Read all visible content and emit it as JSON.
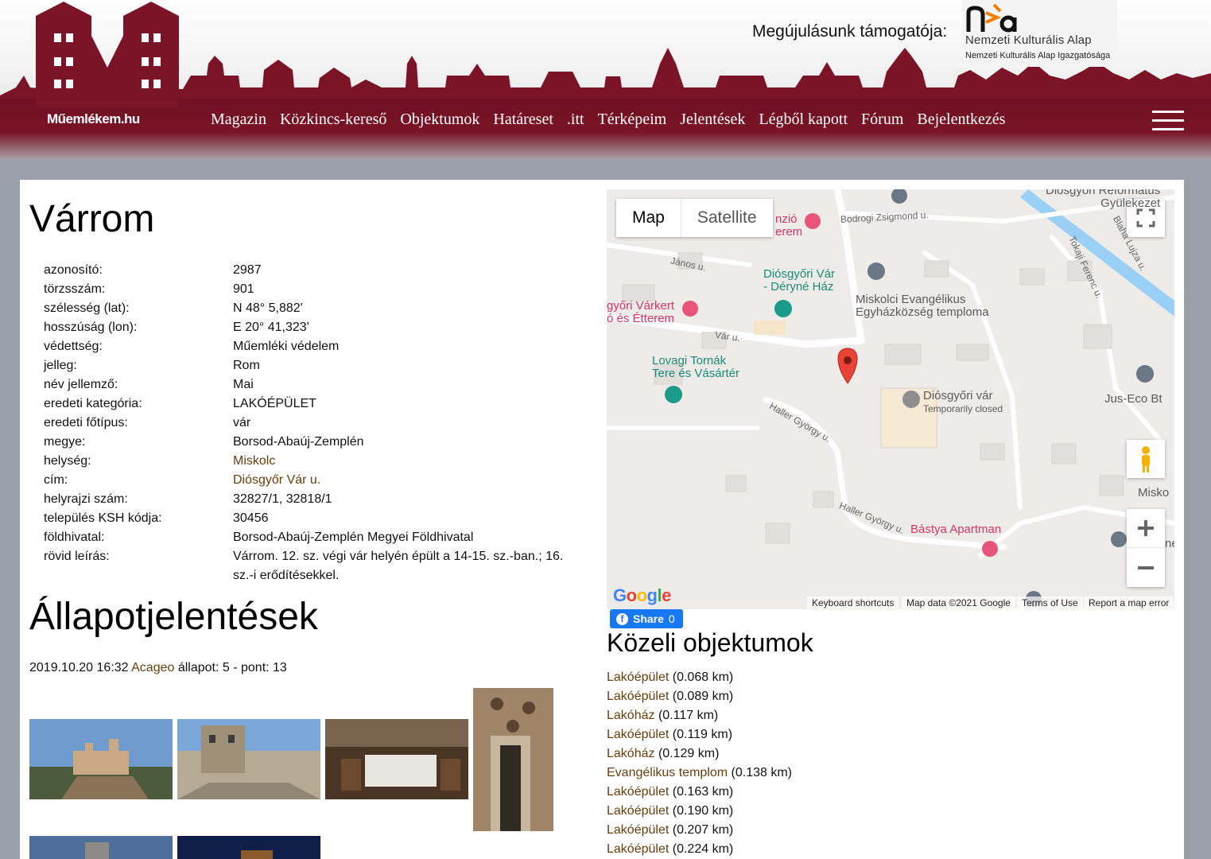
{
  "header": {
    "site_name": "Műemlékem.hu",
    "sponsor_label": "Megújulásunk támogatója:",
    "sponsor_name": "Nemzeti Kulturális Alap",
    "sponsor_sub": "Nemzeti Kulturális Alap Igazgatósága",
    "nav": [
      "Magazin",
      "Közkincs-kereső",
      "Objektumok",
      "Határeset",
      ".itt",
      "Térképeim",
      "Jelentések",
      "Légből kapott",
      "Fórum",
      "Bejelentkezés"
    ],
    "menu_icon": "hamburger-icon",
    "brand_color": "#7a1426"
  },
  "page": {
    "title": "Várrom",
    "details": [
      {
        "label": "azonosító:",
        "value": "2987"
      },
      {
        "label": "törzsszám:",
        "value": "901"
      },
      {
        "label": "szélesség (lat):",
        "value": "N 48° 5,882'"
      },
      {
        "label": "hosszúság (lon):",
        "value": "E 20° 41,323'"
      },
      {
        "label": "védettség:",
        "value": "Műemléki védelem"
      },
      {
        "label": "jelleg:",
        "value": "Rom"
      },
      {
        "label": "név jellemző:",
        "value": "Mai"
      },
      {
        "label": "eredeti kategória:",
        "value": "LAKÓÉPÜLET"
      },
      {
        "label": "eredeti főtípus:",
        "value": "vár"
      },
      {
        "label": "megye:",
        "value": "Borsod-Abaúj-Zemplén"
      },
      {
        "label": "helység:",
        "value": "Miskolc",
        "link": true
      },
      {
        "label": "cím:",
        "value": "Diósgyőr Vár u.",
        "link": true
      },
      {
        "label": "helyrajzi szám:",
        "value": "32827/1, 32818/1"
      },
      {
        "label": "település KSH kódja:",
        "value": "30456"
      },
      {
        "label": "földhivatal:",
        "value": "Borsod-Abaúj-Zemplén Megyei Földhivatal"
      },
      {
        "label": "rövid leírás:",
        "value": "Várrom. 12. sz. végi vár helyén épült a 14-15. sz.-ban.; 16. sz.-i erődítésekkel."
      }
    ]
  },
  "reports": {
    "title": "Állapotjelentések",
    "entry": {
      "datetime": "2019.10.20 16:32",
      "user": "Acageo",
      "status_text": "állapot: 5 - pont: 13"
    }
  },
  "map": {
    "type_active": "Map",
    "type_inactive": "Satellite",
    "labels": {
      "dery_1": "Diósgyőri Vár",
      "dery_2": "- Déryné Ház",
      "lovagi_1": "Lovagi Tornák",
      "lovagi_2": "Tere és Vásártér",
      "evang_1": "Miskolci Evangélikus",
      "evang_2": "Egyházközség temploma",
      "var": "Diósgyőri vár",
      "var_sub": "Temporarily closed",
      "jus": "Jus-Eco Bt",
      "bastya": "Bástya Apartman",
      "varkert_1": "győri Várkert",
      "varkert_2": "ó és Étterem",
      "penzio_1": "nzió",
      "penzio_2": "erem",
      "reformatus_1": "Diósgyőri Református",
      "reformatus_2": "Gyülekezet",
      "misko": "Misko",
      "ne": "ne"
    },
    "streets": {
      "bodrogi": "Bodrogi Zsigmond u.",
      "janos": "János u.",
      "var_u": "Vár u.",
      "haller1": "Haller György u.",
      "haller2": "Haller György u.",
      "tokaji": "Tokaji Ferenc u.",
      "blaha": "Blaha Lujza u."
    },
    "footer": {
      "shortcuts": "Keyboard shortcuts",
      "data": "Map data ©2021 Google",
      "terms": "Terms of Use",
      "report": "Report a map error"
    },
    "google": "Google"
  },
  "share": {
    "label": "Share",
    "count": "0"
  },
  "nearby": {
    "title": "Közeli objektumok",
    "items": [
      {
        "name": "Lakóépület",
        "distance": "(0.068 km)"
      },
      {
        "name": "Lakóépület",
        "distance": "(0.089 km)"
      },
      {
        "name": "Lakóház",
        "distance": "(0.117 km)"
      },
      {
        "name": "Lakóépület",
        "distance": "(0.119 km)"
      },
      {
        "name": "Lakóház",
        "distance": "(0.129 km)"
      },
      {
        "name": "Evangélikus templom",
        "distance": "(0.138 km)"
      },
      {
        "name": "Lakóépület",
        "distance": "(0.163 km)"
      },
      {
        "name": "Lakóépület",
        "distance": "(0.190 km)"
      },
      {
        "name": "Lakóépület",
        "distance": "(0.207 km)"
      },
      {
        "name": "Lakóépület",
        "distance": "(0.224 km)"
      }
    ]
  }
}
